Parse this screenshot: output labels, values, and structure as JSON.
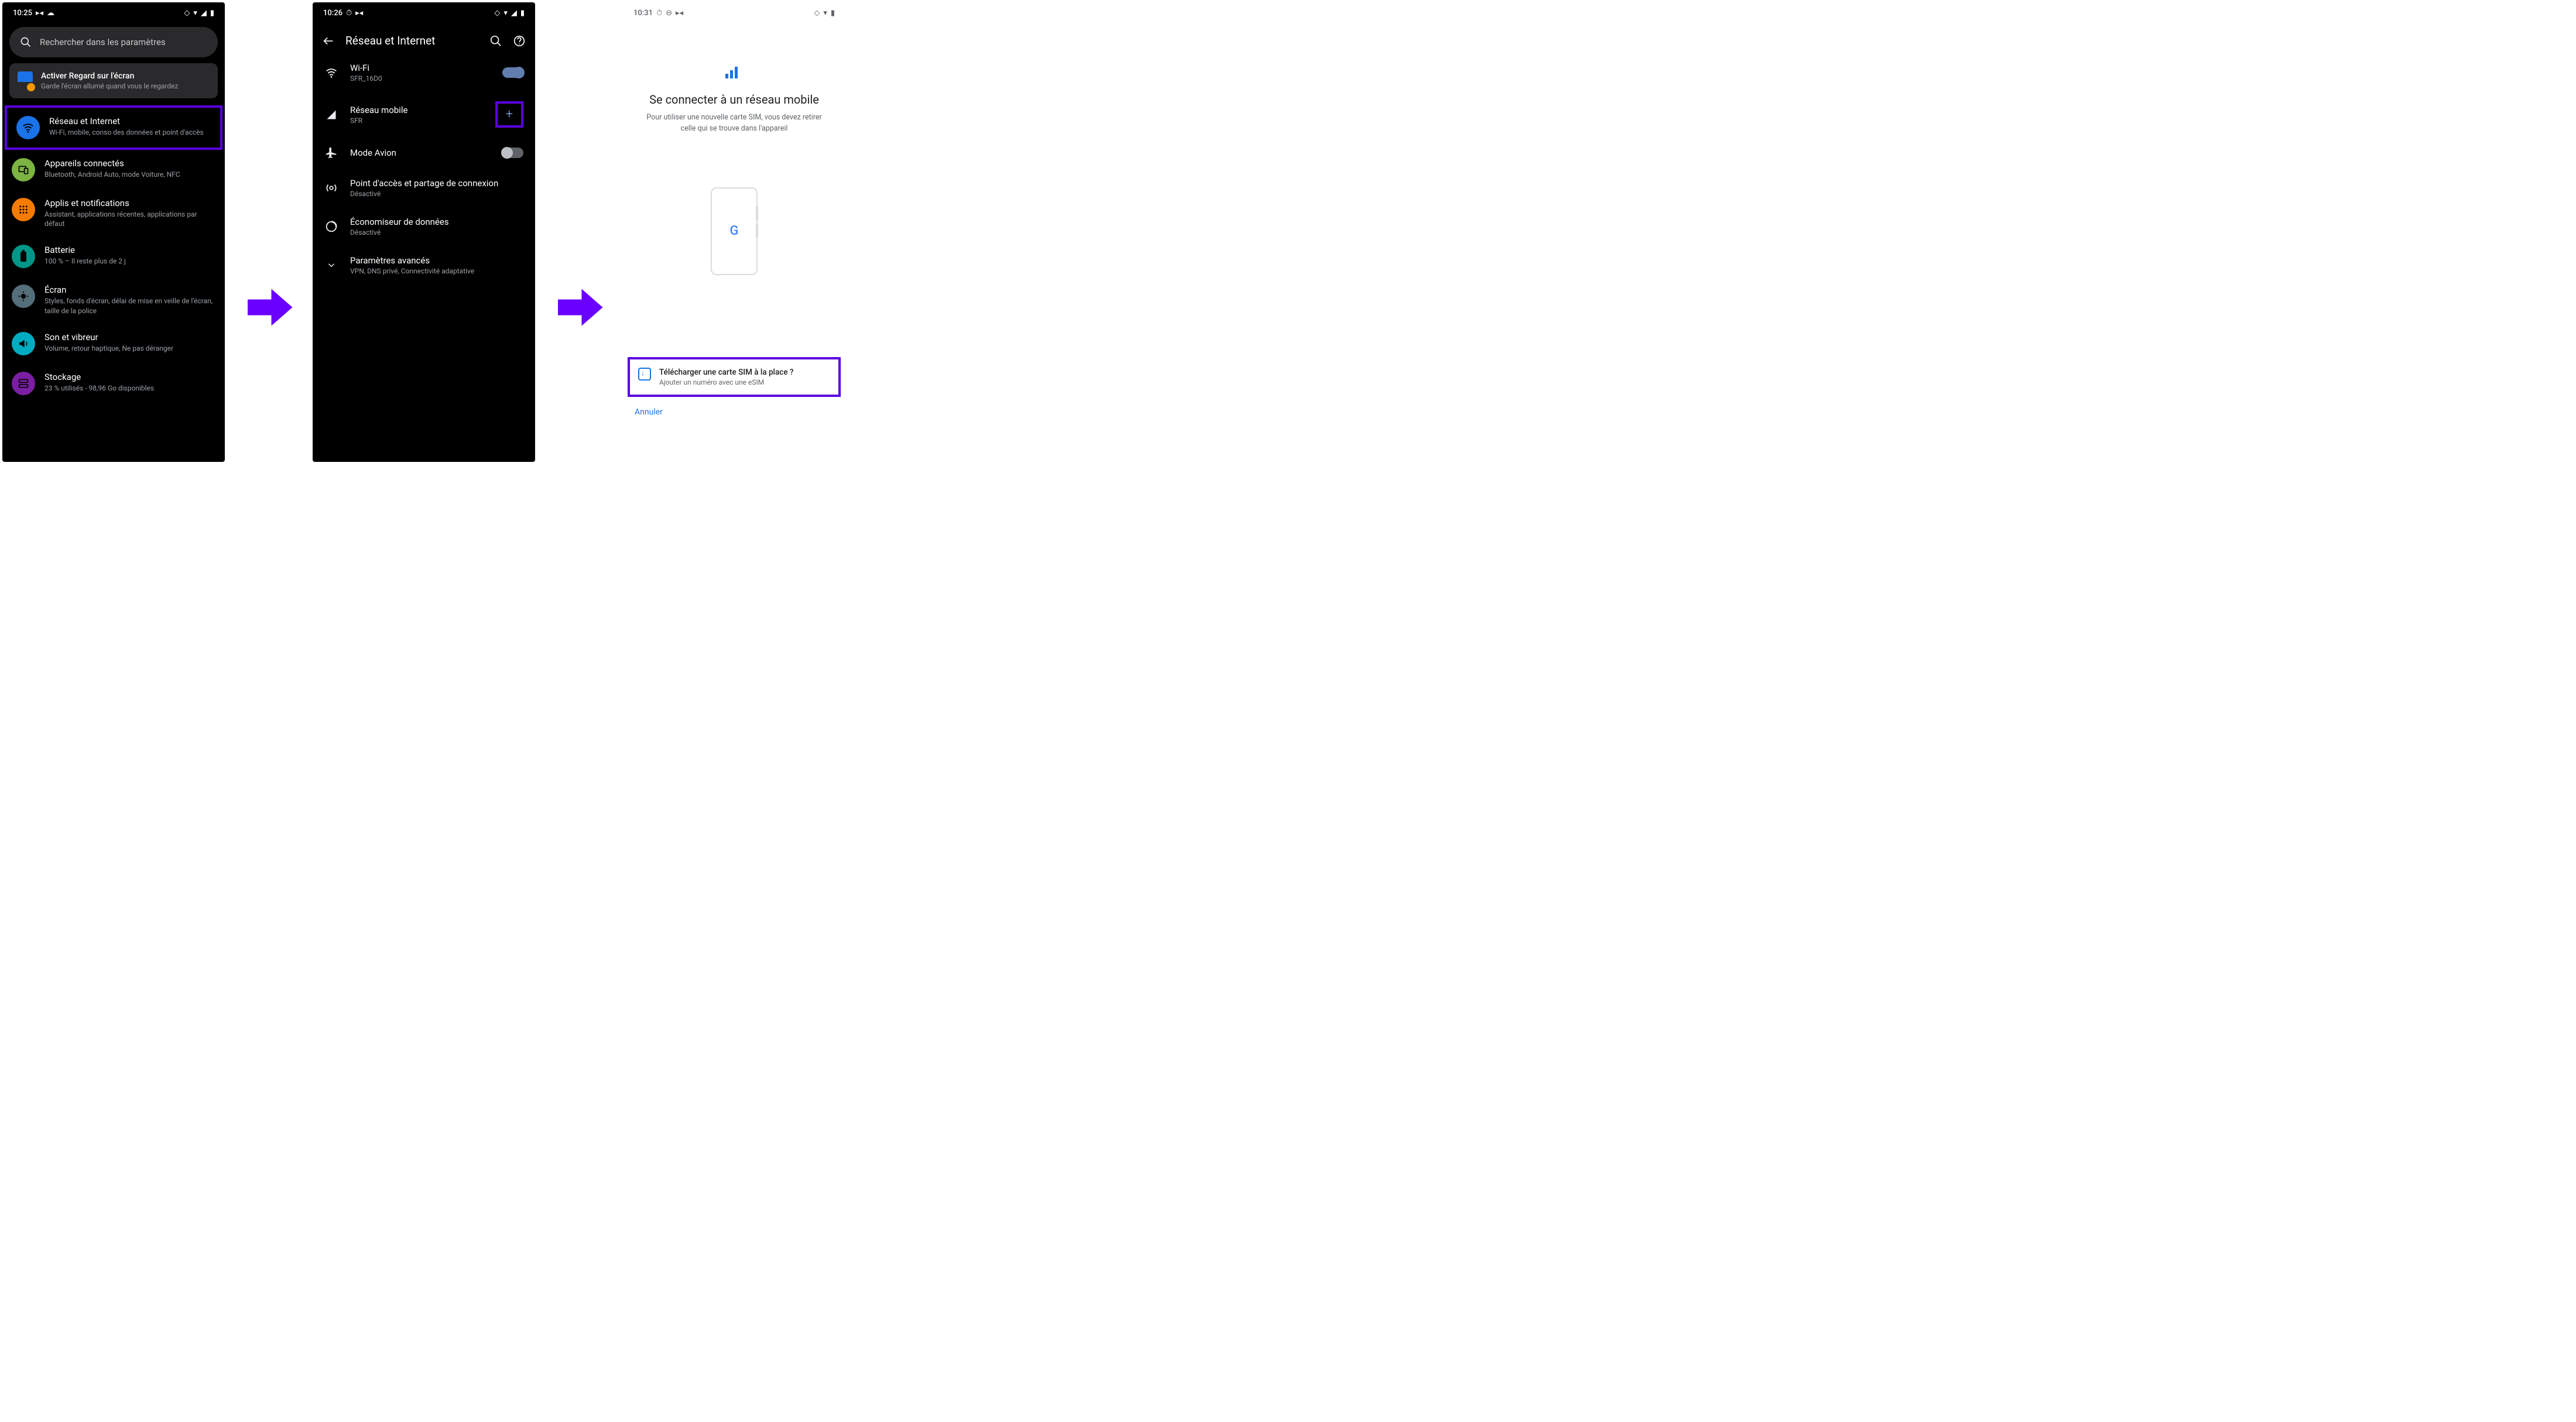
{
  "colors": {
    "highlight": "#5b00e0",
    "accent_blue": "#1a73e8",
    "toggle_on": "#8ab4f8"
  },
  "screen1": {
    "status_time": "10:25",
    "search_placeholder": "Rechercher dans les paramètres",
    "suggestion": {
      "title": "Activer Regard sur l'écran",
      "sub": "Garde l'écran allumé quand vous le regardez"
    },
    "rows": [
      {
        "title": "Réseau et Internet",
        "sub": "Wi-Fi, mobile, conso des données et point d'accès",
        "icon_bg": "#1a73e8",
        "icon": "wifi",
        "highlight": true
      },
      {
        "title": "Appareils connectés",
        "sub": "Bluetooth, Android Auto, mode Voiture, NFC",
        "icon_bg": "#7cb342",
        "icon": "devices"
      },
      {
        "title": "Applis et notifications",
        "sub": "Assistant, applications récentes, applications par défaut",
        "icon_bg": "#f57c00",
        "icon": "apps"
      },
      {
        "title": "Batterie",
        "sub": "100 % – Il reste plus de 2 j",
        "icon_bg": "#009688",
        "icon": "battery"
      },
      {
        "title": "Écran",
        "sub": "Styles, fonds d'écran, délai de mise en veille de l'écran, taille de la police",
        "icon_bg": "#546e7a",
        "icon": "display"
      },
      {
        "title": "Son et vibreur",
        "sub": "Volume, retour haptique, Ne pas déranger",
        "icon_bg": "#00acc1",
        "icon": "sound"
      },
      {
        "title": "Stockage",
        "sub": "23 % utilisés - 98,96 Go disponibles",
        "icon_bg": "#7b1fa2",
        "icon": "storage"
      }
    ]
  },
  "screen2": {
    "status_time": "10:26",
    "title": "Réseau et Internet",
    "rows": [
      {
        "icon": "wifi",
        "title": "Wi-Fi",
        "sub": "SFR_16D0",
        "toggle": "on"
      },
      {
        "icon": "signal",
        "title": "Réseau mobile",
        "sub": "SFR",
        "action": "plus",
        "highlight": true
      },
      {
        "icon": "airplane",
        "title": "Mode Avion",
        "toggle": "off"
      },
      {
        "icon": "hotspot",
        "title": "Point d'accès et partage de connexion",
        "sub": "Désactivé"
      },
      {
        "icon": "datasaver",
        "title": "Économiseur de données",
        "sub": "Désactivé"
      },
      {
        "icon": "expand",
        "title": "Paramètres avancés",
        "sub": "VPN, DNS privé, Connectivité adaptative"
      }
    ]
  },
  "screen3": {
    "status_time": "10:31",
    "title": "Se connecter à un réseau mobile",
    "sub": "Pour utiliser une nouvelle carte SIM, vous devez retirer celle qui se trouve dans l'appareil",
    "esim": {
      "title": "Télécharger une carte SIM à la place ?",
      "sub": "Ajouter un numéro avec une eSIM"
    },
    "cancel": "Annuler"
  }
}
